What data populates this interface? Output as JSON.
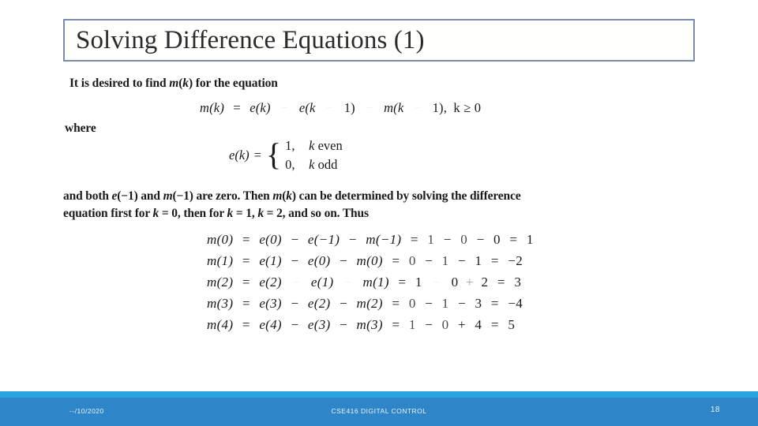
{
  "slide": {
    "title": "Solving Difference Equations (1)",
    "title_border_color": "#7c8bab"
  },
  "content": {
    "intro_line": "It is desired to find m(k) for the equation",
    "main_equation": {
      "lhs": "m(k)",
      "eq": "=",
      "t1": "e(k)",
      "op1": "−",
      "t2": "e(k",
      "op2": "−",
      "t3": "1)",
      "op3": "−",
      "t4": "m(k",
      "op4": "−",
      "t5": "1),",
      "condition": "k ≥ 0",
      "plain": "m(k) = e(k) − e(k − 1) − m(k − 1), k ≥ 0"
    },
    "where_label": "where",
    "piecewise": {
      "lhs": "e(k)",
      "eq": "=",
      "rows": [
        {
          "value": "1,",
          "condition": "k even"
        },
        {
          "value": "0,",
          "condition": "k odd"
        }
      ],
      "plain": "e(k) = { 1, k even ; 0, k odd }"
    },
    "paragraph_line1": "and both e(−1) and m(−1) are zero. Then m(k) can be determined by solving the difference",
    "paragraph_line2": "equation first for k = 0, then for k = 1, k = 2, and so on. Thus",
    "derivation": [
      {
        "lhs": "m(0)",
        "eq1": "=",
        "a": "e(0)",
        "op1": "−",
        "b": "e(−1)",
        "op2": "−",
        "c": "m(−1)",
        "eq2": "=",
        "n1": "1",
        "op3": "−",
        "n2": "0",
        "op4": "−",
        "n3": "0",
        "eq3": "=",
        "result": "1",
        "plain": "m(0) = e(0) − e(−1) − m(−1) = 1 − 0 − 0 = 1"
      },
      {
        "lhs": "m(1)",
        "eq1": "=",
        "a": "e(1)",
        "op1": "−",
        "b": "e(0)",
        "op2": "−",
        "c": "m(0)",
        "eq2": "=",
        "n1": "0",
        "op3": "−",
        "n2": "1",
        "op4": "−",
        "n3": "1",
        "eq3": "=",
        "result": "−2",
        "plain": "m(1) = e(1) − e(0) − m(0) = 0 − 1 − 1 = −2"
      },
      {
        "lhs": "m(2)",
        "eq1": "=",
        "a": "e(2)",
        "op1": "−",
        "b": "e(1)",
        "op2": "−",
        "c": "m(1)",
        "eq2": "=",
        "n1": "1",
        "op3": "−",
        "n2": "0",
        "op4": "+",
        "n3": "2",
        "eq3": "=",
        "result": "3",
        "plain": "m(2) = e(2) − e(1) − m(1) = 1 − 0 + 2 = 3"
      },
      {
        "lhs": "m(3)",
        "eq1": "=",
        "a": "e(3)",
        "op1": "−",
        "b": "e(2)",
        "op2": "−",
        "c": "m(2)",
        "eq2": "=",
        "n1": "0",
        "op3": "−",
        "n2": "1",
        "op4": "−",
        "n3": "3",
        "eq3": "=",
        "result": "−4",
        "plain": "m(3) = e(3) − e(2) − m(2) = 0 − 1 − 3 = −4"
      },
      {
        "lhs": "m(4)",
        "eq1": "=",
        "a": "e(4)",
        "op1": "−",
        "b": "e(3)",
        "op2": "−",
        "c": "m(3)",
        "eq2": "=",
        "n1": "1",
        "op3": "−",
        "n2": "0",
        "op4": "+",
        "n3": "4",
        "eq3": "=",
        "result": "5",
        "plain": "m(4) = e(4) − e(3) − m(3) = 1 − 0 + 4 = 5"
      }
    ]
  },
  "footer": {
    "date": "--/10/2020",
    "course": "CSE416 DIGITAL CONTROL",
    "page_number": "18",
    "bar_color": "#2e86c8",
    "accent_color": "#29a3dc"
  }
}
